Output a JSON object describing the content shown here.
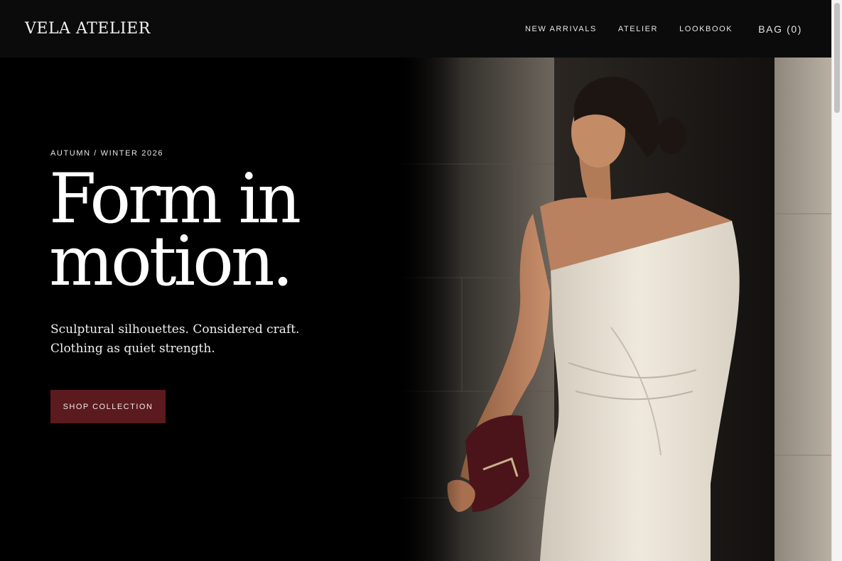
{
  "brand": {
    "name": "VELA ATELIER"
  },
  "nav": {
    "items": [
      {
        "label": "NEW ARRIVALS"
      },
      {
        "label": "ATELIER"
      },
      {
        "label": "LOOKBOOK"
      }
    ],
    "bag_label": "BAG (0)"
  },
  "hero": {
    "eyebrow": "AUTUMN / WINTER 2026",
    "headline_line1": "Form in",
    "headline_line2": "motion.",
    "subtext_line1": "Sculptural silhouettes. Considered craft.",
    "subtext_line2": "Clothing as quiet strength.",
    "cta_label": "SHOP COLLECTION",
    "image_subject": "model-in-white-one-shoulder-dress-with-burgundy-clutch"
  },
  "colors": {
    "header_bg": "#0b0b0b",
    "hero_bg": "#000000",
    "cta_bg": "#5a1a1e",
    "text": "#ffffff"
  }
}
